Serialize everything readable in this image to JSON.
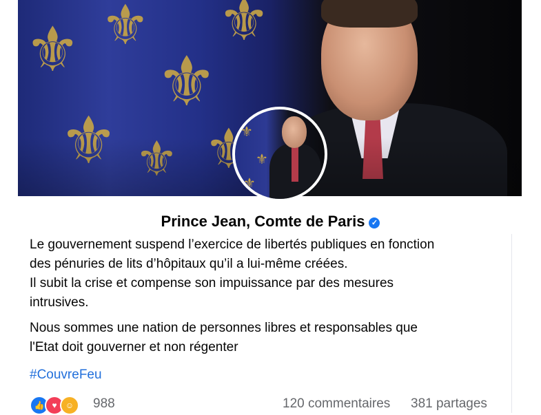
{
  "page": {
    "name": "Prince Jean, Comte de Paris",
    "verified": true
  },
  "post": {
    "paragraph1_lines": [
      "Le gouvernement suspend l’exercice de libertés publiques en fonction",
      "des pénuries de lits d’hôpitaux qu’il a lui-même créées.",
      "Il subit la crise et compense son impuissance par des mesures",
      "intrusives."
    ],
    "paragraph2_lines": [
      "Nous sommes une nation de personnes libres et responsables que",
      "l'Etat doit gouverner et non régenter"
    ],
    "hashtag": "#CouvreFeu"
  },
  "engagement": {
    "reactions": [
      "like-icon",
      "love-icon",
      "care-icon"
    ],
    "reaction_count": "988",
    "comments": "120 commentaires",
    "shares": "381 partages"
  },
  "colors": {
    "hashtag": "#216fdb",
    "verified_badge": "#1877f2",
    "muted_text": "#65676b"
  }
}
